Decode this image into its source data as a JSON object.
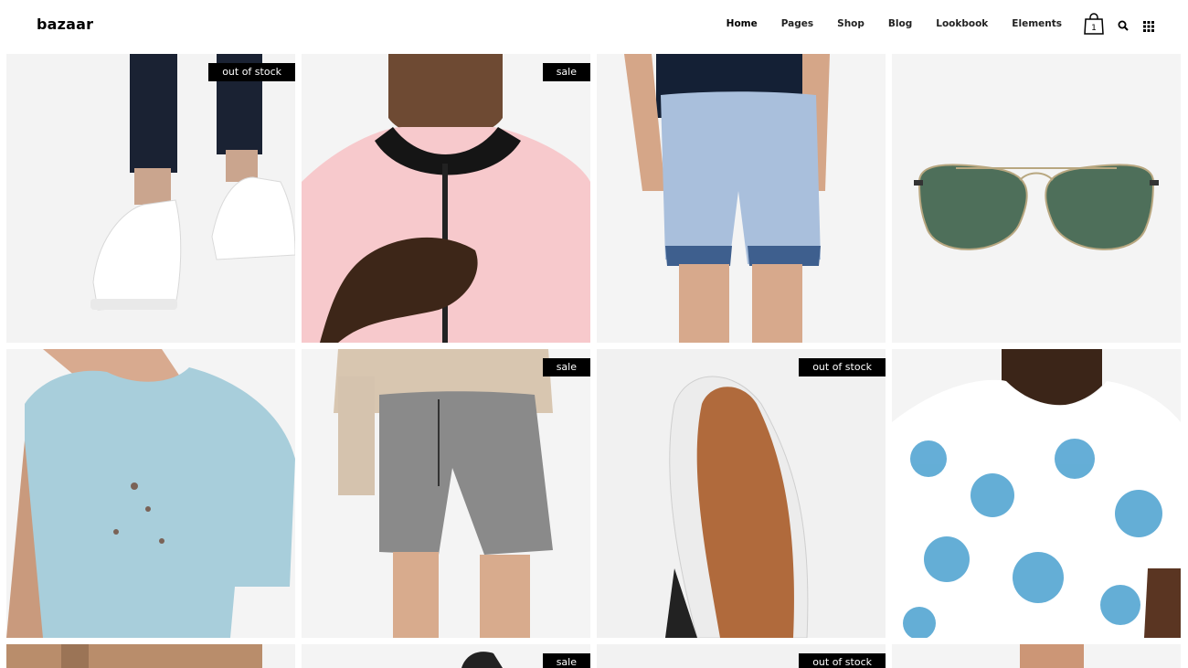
{
  "brand": {
    "logo": "bazaar"
  },
  "nav": {
    "items": [
      {
        "label": "Home"
      },
      {
        "label": "Pages"
      },
      {
        "label": "Shop"
      },
      {
        "label": "Blog"
      },
      {
        "label": "Lookbook"
      },
      {
        "label": "Elements"
      }
    ],
    "active": "Home"
  },
  "header_icons": {
    "cart": {
      "icon": "shopping-bag-icon",
      "count": "1"
    },
    "search": {
      "icon": "search-icon"
    },
    "menu": {
      "icon": "grid-menu-icon"
    }
  },
  "products": [
    {
      "name": "white sneakers",
      "badge": "out of stock"
    },
    {
      "name": "pink bomber jacket",
      "badge": "sale"
    },
    {
      "name": "linen shorts",
      "badge": ""
    },
    {
      "name": "aviator sunglasses",
      "badge": ""
    },
    {
      "name": "distressed t-shirt",
      "badge": ""
    },
    {
      "name": "grey shorts",
      "badge": "sale"
    },
    {
      "name": "sneaker sole",
      "badge": "out of stock"
    },
    {
      "name": "floral t-shirt",
      "badge": ""
    },
    {
      "name": "suede jacket",
      "badge": ""
    },
    {
      "name": "black sneaker",
      "badge": "sale"
    },
    {
      "name": "product",
      "badge": "out of stock"
    },
    {
      "name": "shirt",
      "badge": ""
    }
  ],
  "colors": {
    "badge_bg": "#000000",
    "badge_text": "#ffffff",
    "tile_bg": "#f2f2f2"
  }
}
